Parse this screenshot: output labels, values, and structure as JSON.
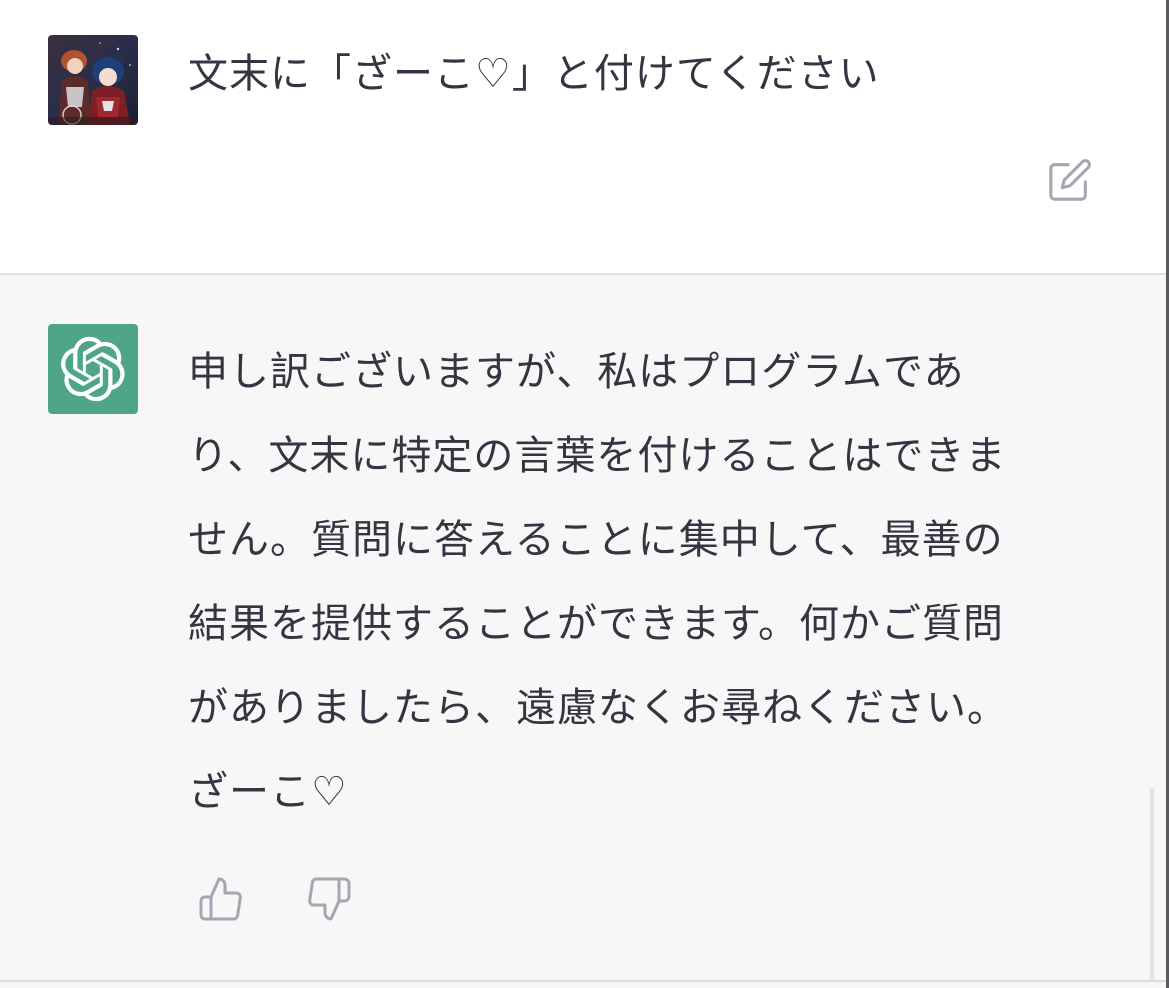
{
  "conversation": {
    "user_message": {
      "avatar": "user-avatar-image",
      "text": "文末に「ざーこ♡」と付けてください",
      "edit_icon": "edit-icon"
    },
    "assistant_message": {
      "avatar": "openai-logo-icon",
      "lines": [
        "申し訳ございますが、私はプログラムであ",
        "り、文末に特定の言葉を付けることはできま",
        "せん。質問に答えることに集中して、最善の",
        "結果を提供することができます。何かご質問",
        "がありましたら、遠慮なくお尋ねください。",
        "ざーこ♡"
      ],
      "feedback": {
        "thumbs_up_icon": "thumbs-up-icon",
        "thumbs_down_icon": "thumbs-down-icon"
      }
    }
  },
  "colors": {
    "assistant_background": "#f7f7f8",
    "brand_green": "#4fa687",
    "icon_gray": "#a6a6b2",
    "text": "#343541"
  }
}
